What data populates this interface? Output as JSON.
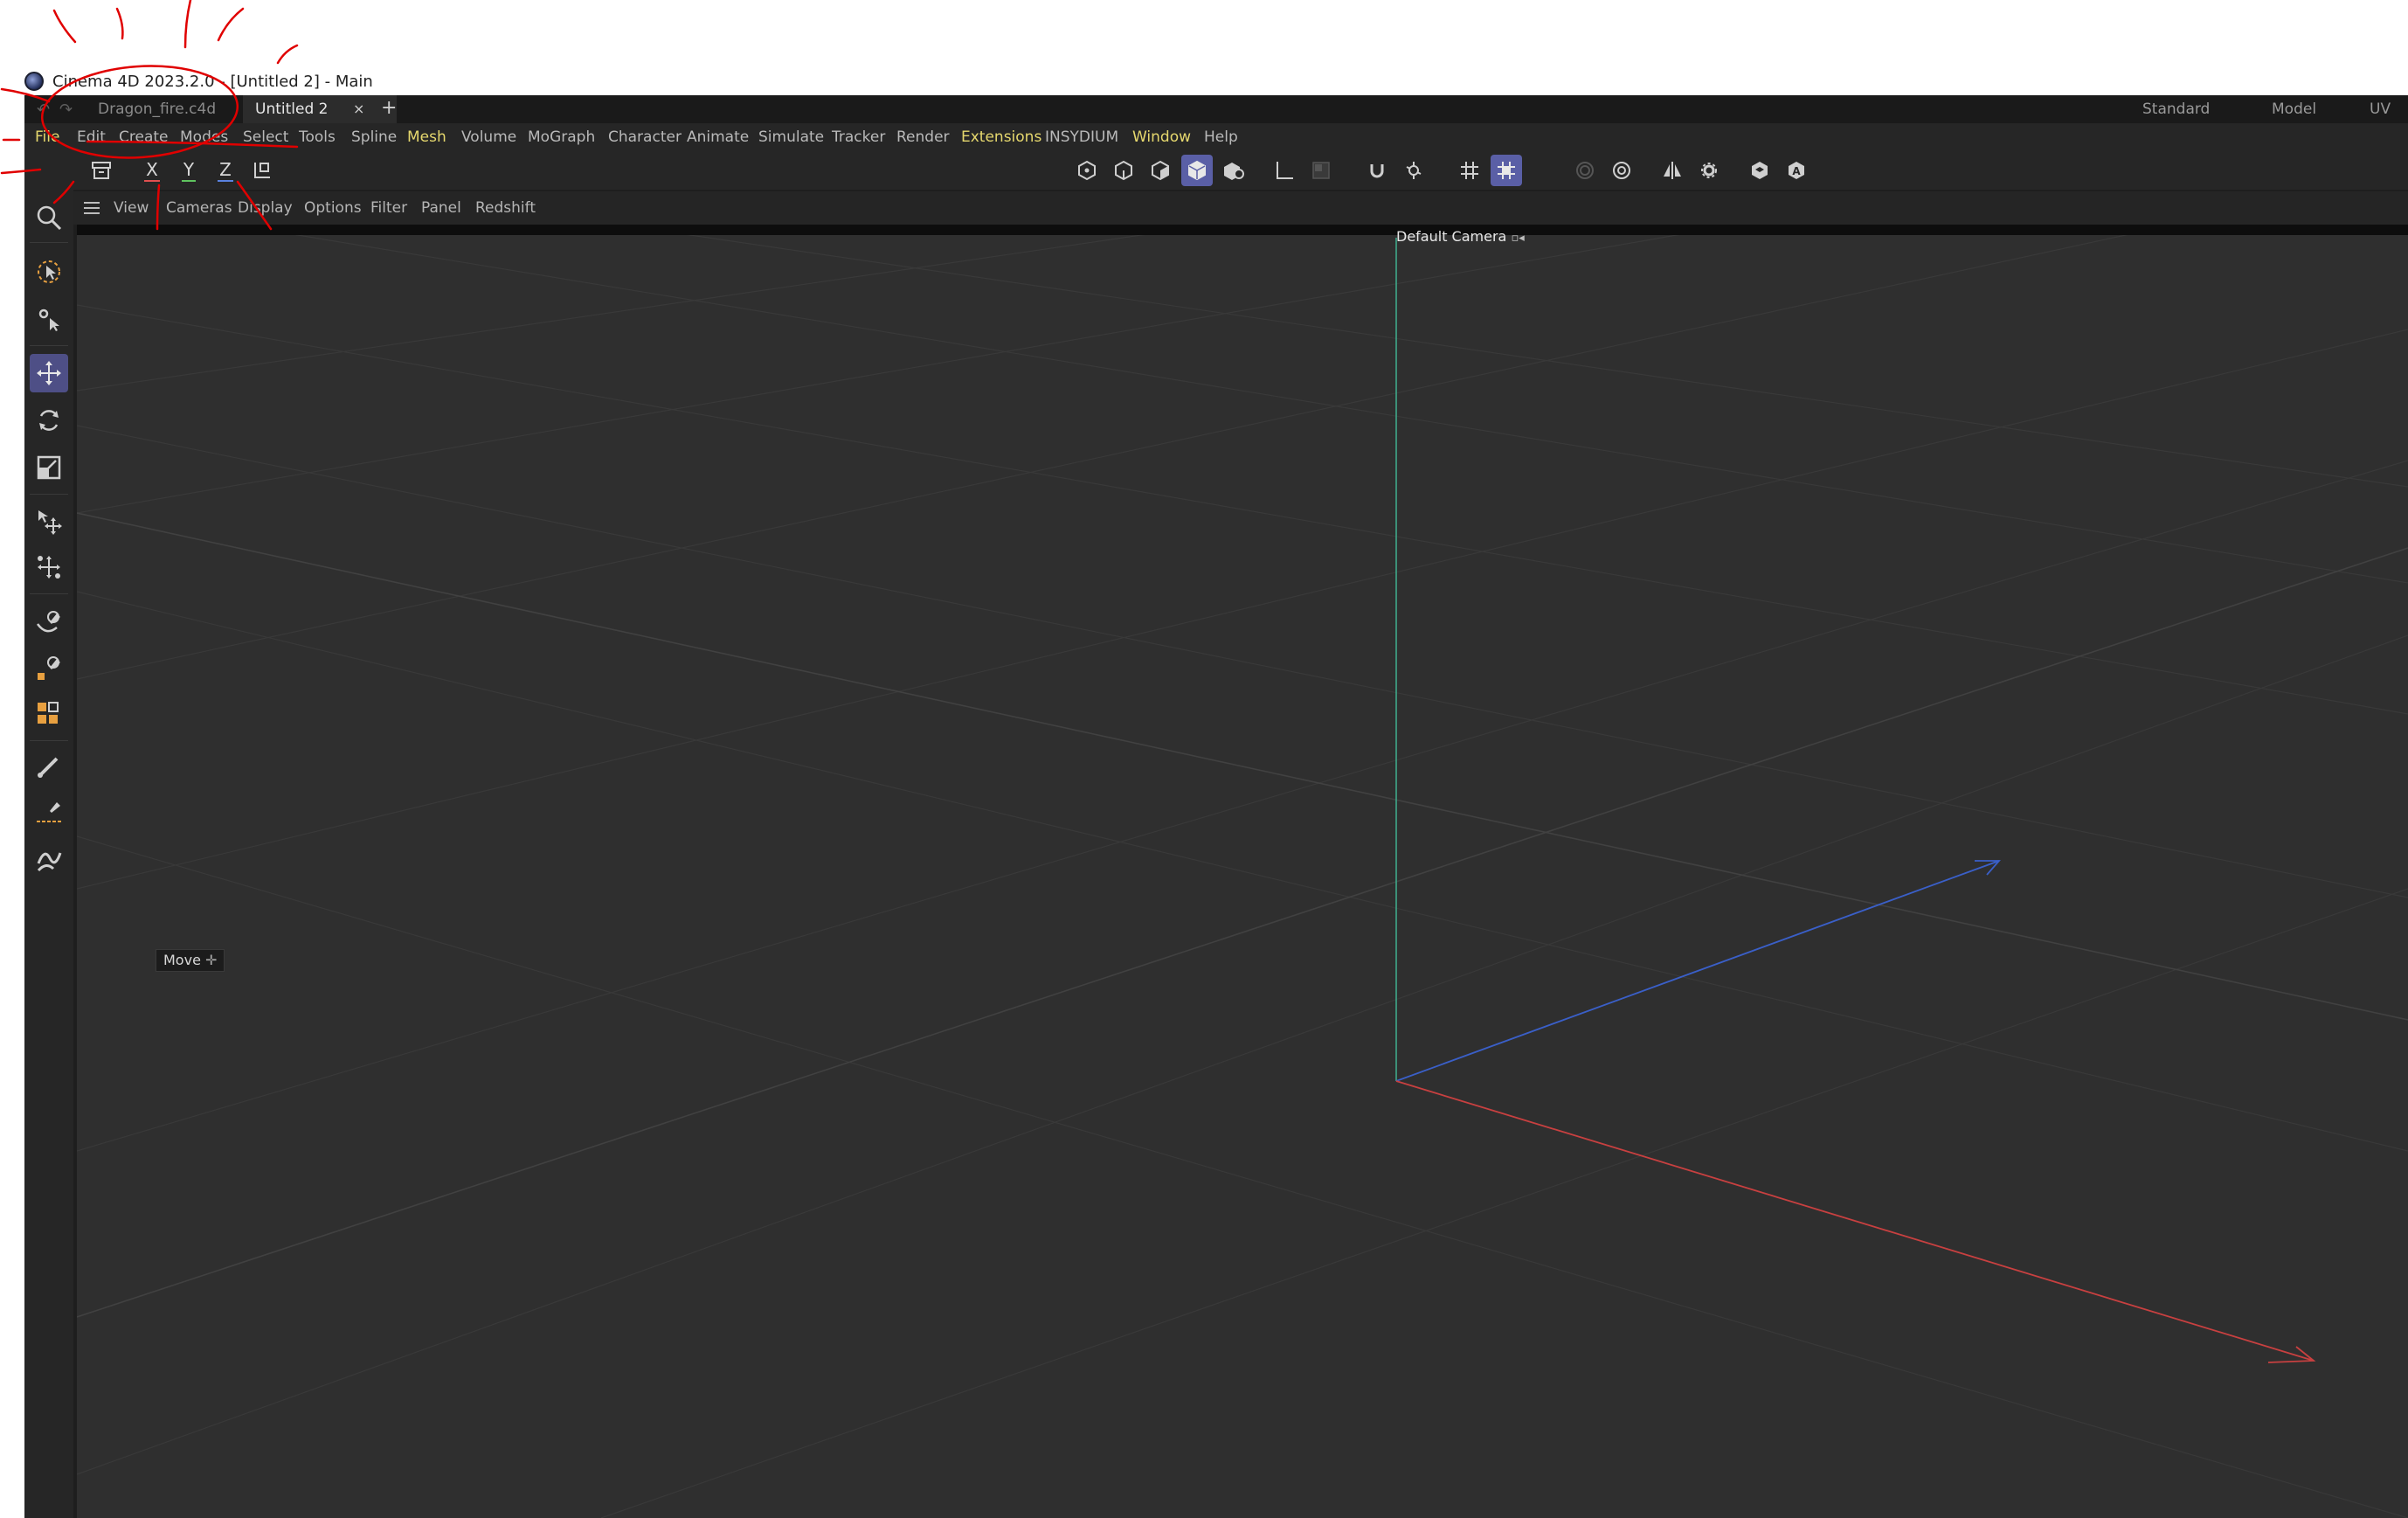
{
  "window": {
    "title": "Cinema 4D 2023.2.0 - [Untitled 2] - Main",
    "icon": "cinema4d-logo-icon"
  },
  "tabs": [
    {
      "label": "Dragon_fire.c4d",
      "active": false
    },
    {
      "label": "Untitled 2",
      "active": true
    }
  ],
  "tab_close": "×",
  "tab_add": "+",
  "layouts": [
    "Standard",
    "Model",
    "UV Edit"
  ],
  "menu": [
    {
      "label": "File",
      "highlight": true
    },
    {
      "label": "Edit"
    },
    {
      "label": "Create"
    },
    {
      "label": "Modes"
    },
    {
      "label": "Select"
    },
    {
      "label": "Tools"
    },
    {
      "label": "Spline"
    },
    {
      "label": "Mesh",
      "highlight": true
    },
    {
      "label": "Volume"
    },
    {
      "label": "MoGraph"
    },
    {
      "label": "Character"
    },
    {
      "label": "Animate"
    },
    {
      "label": "Simulate"
    },
    {
      "label": "Tracker"
    },
    {
      "label": "Render"
    },
    {
      "label": "Extensions",
      "highlight": true
    },
    {
      "label": "INSYDIUM"
    },
    {
      "label": "Window",
      "highlight": true
    },
    {
      "label": "Help"
    }
  ],
  "axis_buttons": [
    {
      "label": "X",
      "color": "#e05050"
    },
    {
      "label": "Y",
      "color": "#5fc45f"
    },
    {
      "label": "Z",
      "color": "#5a82e0"
    }
  ],
  "view_menu": [
    "View",
    "Cameras",
    "Display",
    "Options",
    "Filter",
    "Panel",
    "Redshift"
  ],
  "viewport": {
    "camera_label": "Default Camera",
    "tooltip": "Move",
    "axis_colors": {
      "x": "#c84040",
      "y": "#3fa98a",
      "z": "#3a5fc8"
    },
    "background": "#2f2f2f",
    "grid_color": "#393939"
  },
  "colors": {
    "accent_active": "#5a5fa6",
    "menu_highlight": "#e6d86e",
    "annotation_red": "#e00000"
  }
}
